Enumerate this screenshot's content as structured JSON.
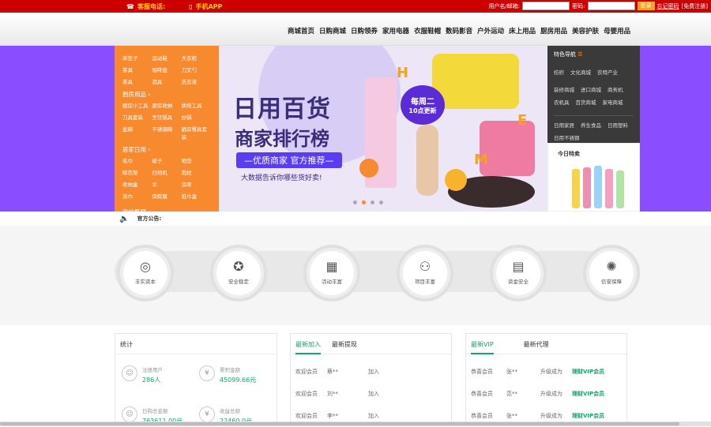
{
  "topbar": {
    "hotline_label": "客服电话:",
    "app_label": "手机APP",
    "username_label": "用户名/邮箱:",
    "password_label": "密码:",
    "login_btn": "登录",
    "forgot_link": "忘记密码",
    "register_link": "[免费注册]"
  },
  "nav": {
    "items": [
      "商城首页",
      "日购商城",
      "日购领券",
      "家用电器",
      "衣服鞋帽",
      "数码影音",
      "户外运动",
      "床上用品",
      "厨房用品",
      "美容护肤",
      "母婴用品"
    ]
  },
  "menu": {
    "cat0": [
      "床垫子",
      "运动鞋",
      "大衣柜",
      "茶具",
      "咖啡壶",
      "刀叉勺",
      "茶具",
      "酒具",
      "洗衣液"
    ],
    "cat1_title": "厨房用品",
    "cat1": [
      "厨房小工具",
      "厨房收纳",
      "烘焙工具",
      "刀具套装",
      "烹饪锅具",
      "炒锅",
      "盆碗",
      "不锈钢碗",
      "厨房餐具套装"
    ],
    "cat2_title": "居家日用",
    "cat2": [
      "毛巾",
      "被子",
      "地垫",
      "晾衣架",
      "扫地机",
      "抱枕",
      "收纳盒",
      "伞",
      "凉席",
      "浴巾",
      "保鲜膜",
      "纸巾盒"
    ],
    "cat3_title": "收纳整理"
  },
  "banner": {
    "title": "日用百货",
    "subtitle": "商家排行榜",
    "tag": "—优质商家 官方推荐—",
    "note": "大数据告诉你哪些货好卖!",
    "badge_line1": "每周二",
    "badge_line2": "10点更新"
  },
  "right_panel": {
    "title": "特色导航",
    "row1": [
      "纺织",
      "文化商城",
      "农特产业"
    ],
    "row2": [
      "装修商城",
      "进口商城",
      "商务机",
      "农机具",
      "百货商城",
      "家电商城"
    ],
    "row3": [
      "日用家居",
      "养生食品",
      "日用塑料",
      "日用不锈钢"
    ]
  },
  "today": {
    "title": "今日特卖"
  },
  "notice": {
    "label": "官方公告:"
  },
  "features": [
    {
      "label": "丰实资本",
      "icon": "coins-icon",
      "glyph": "◎"
    },
    {
      "label": "安全稳定",
      "icon": "medal-icon",
      "glyph": "✪"
    },
    {
      "label": "活动丰富",
      "icon": "boxes-icon",
      "glyph": "▦"
    },
    {
      "label": "项目丰富",
      "icon": "network-icon",
      "glyph": "⚇"
    },
    {
      "label": "资金安全",
      "icon": "calculator-icon",
      "glyph": "▤"
    },
    {
      "label": "信誉保障",
      "icon": "lightbulb-icon",
      "glyph": "✺"
    }
  ],
  "stats": {
    "title": "统计",
    "registered_label": "注册用户",
    "registered_value": "286人",
    "invest_label": "累积金额",
    "invest_value": "45099.66元",
    "total_label": "日购总金额",
    "total_value": "763611.00元",
    "income_label": "收益总额",
    "income_value": "22460.0元"
  },
  "members": {
    "tab_active": "最新加入",
    "tab_other": "最新提现",
    "rows": [
      {
        "who": "欢迎会员",
        "name": "蔡**",
        "act": "加入"
      },
      {
        "who": "欢迎会员",
        "name": "刘**",
        "act": "加入"
      },
      {
        "who": "欢迎会员",
        "name": "李**",
        "act": "加入"
      }
    ]
  },
  "vip": {
    "tab_active": "最新VIP",
    "tab_other": "最新代理",
    "rows": [
      {
        "who": "恭喜会员",
        "name": "张**",
        "act": "升级成为",
        "tier": "理财VIP会员"
      },
      {
        "who": "恭喜会员",
        "name": "范**",
        "act": "升级成为",
        "tier": "理财VIP会员"
      },
      {
        "who": "恭喜会员",
        "name": "张**",
        "act": "升级成为",
        "tier": "理财VIP会员"
      }
    ]
  }
}
